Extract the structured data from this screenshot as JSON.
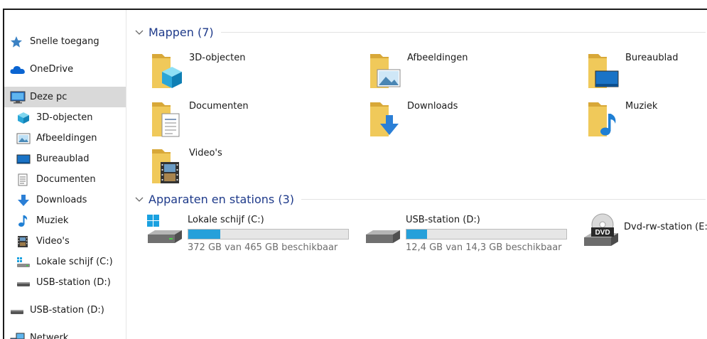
{
  "sidebar": {
    "items": [
      {
        "label": "Snelle toegang",
        "icon": "star-icon"
      },
      {
        "label": "OneDrive",
        "icon": "cloud-icon"
      },
      {
        "label": "Deze pc",
        "icon": "computer-icon"
      },
      {
        "label": "3D-objecten",
        "icon": "cube-icon"
      },
      {
        "label": "Afbeeldingen",
        "icon": "picture-icon"
      },
      {
        "label": "Bureaublad",
        "icon": "desktop-icon"
      },
      {
        "label": "Documenten",
        "icon": "document-icon"
      },
      {
        "label": "Downloads",
        "icon": "download-arrow-icon"
      },
      {
        "label": "Muziek",
        "icon": "music-note-icon"
      },
      {
        "label": "Video's",
        "icon": "film-icon"
      },
      {
        "label": "Lokale schijf (C:)",
        "icon": "windows-drive-icon"
      },
      {
        "label": "USB-station (D:)",
        "icon": "usb-drive-icon"
      },
      {
        "label": "USB-station (D:)",
        "icon": "usb-drive-icon"
      },
      {
        "label": "Netwerk",
        "icon": "network-icon"
      }
    ]
  },
  "main": {
    "folders_header": "Mappen (7)",
    "folders": [
      {
        "label": "3D-objecten",
        "icon": "folder-3d-objects-icon"
      },
      {
        "label": "Afbeeldingen",
        "icon": "folder-pictures-icon"
      },
      {
        "label": "Bureaublad",
        "icon": "folder-desktop-icon"
      },
      {
        "label": "Documenten",
        "icon": "folder-documents-icon"
      },
      {
        "label": "Downloads",
        "icon": "folder-downloads-icon"
      },
      {
        "label": "Muziek",
        "icon": "folder-music-icon"
      },
      {
        "label": "Video's",
        "icon": "folder-videos-icon"
      }
    ],
    "devices_header": "Apparaten en stations (3)",
    "devices": [
      {
        "label": "Lokale schijf (C:)",
        "free_text": "372 GB van 465 GB beschikbaar",
        "used_fraction": 0.2,
        "icon": "windows-hard-drive-icon"
      },
      {
        "label": "USB-station (D:)",
        "free_text": "12,4 GB van 14,3 GB beschikbaar",
        "used_fraction": 0.13,
        "icon": "usb-drive-icon"
      },
      {
        "label": "Dvd-rw-station (E:)",
        "icon": "dvd-drive-icon",
        "dvd_text": "DVD"
      }
    ]
  },
  "colors": {
    "folder_yellow": "#f0c95a",
    "accent_blue": "#26a0da",
    "header_blue": "#1e3a8a",
    "selection_gray": "#d9d9d9"
  }
}
